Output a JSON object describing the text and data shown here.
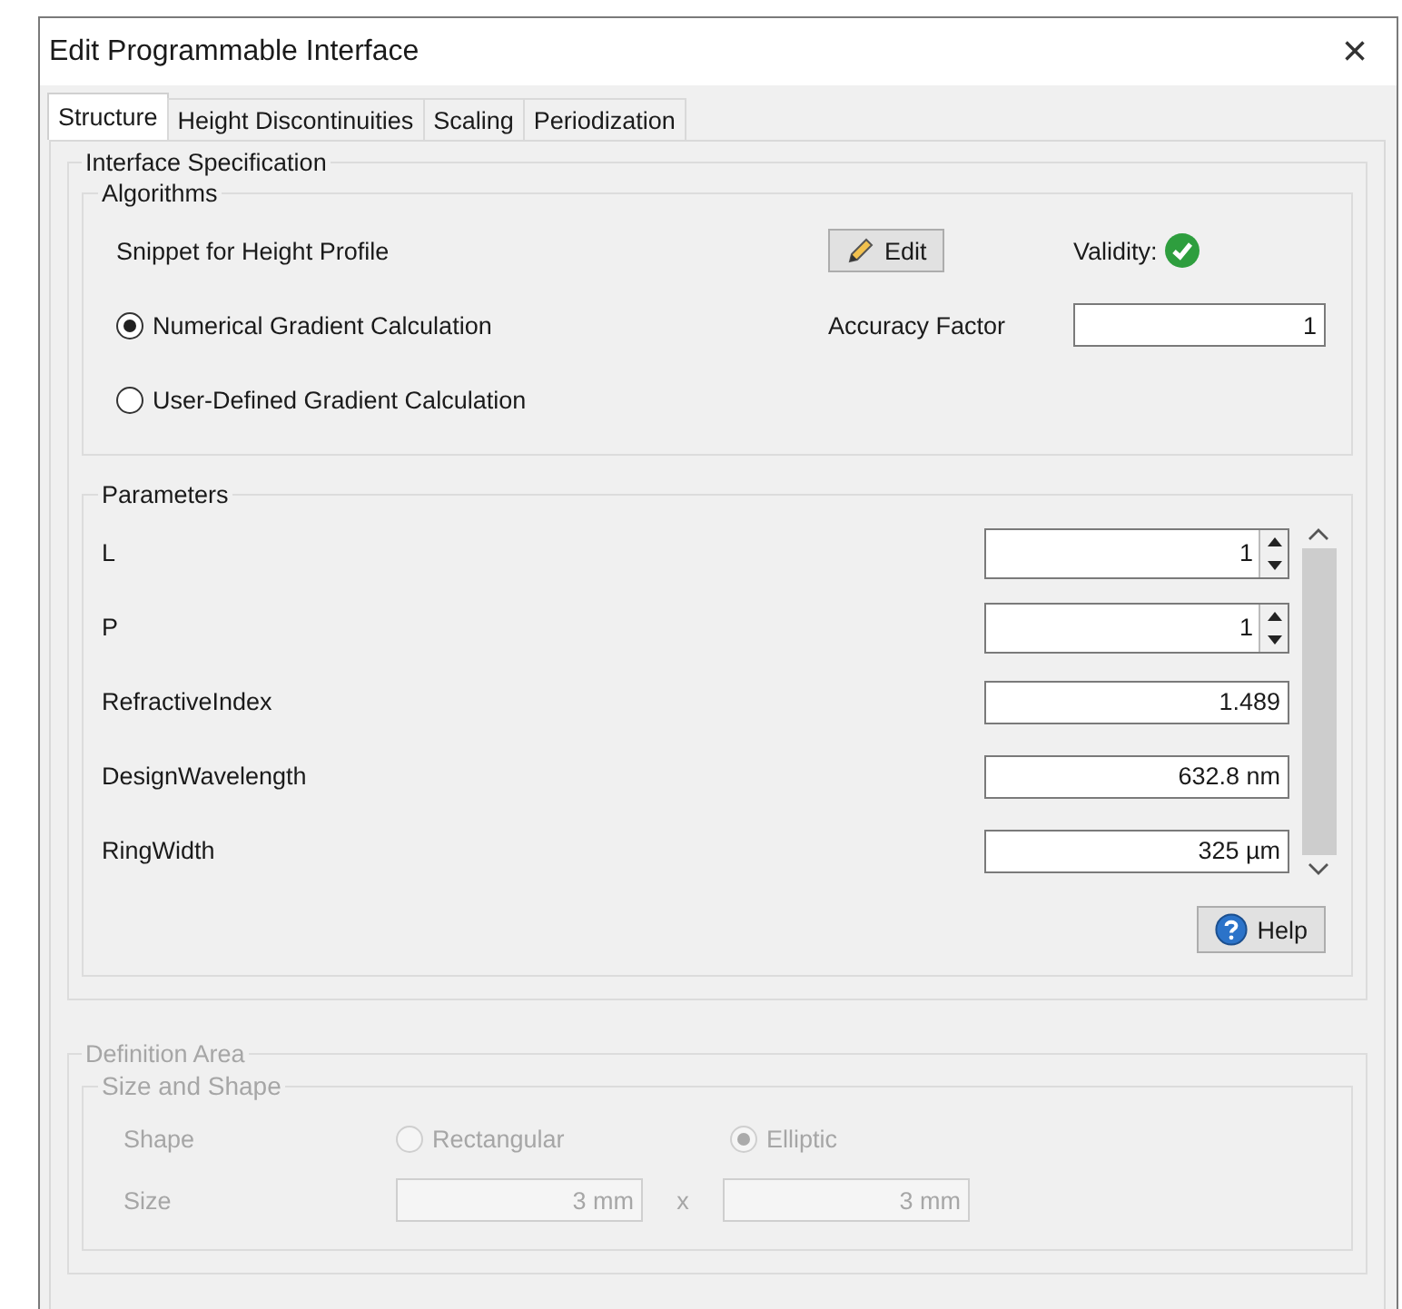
{
  "window": {
    "title": "Edit Programmable Interface",
    "close": "×"
  },
  "tabs": [
    {
      "label": "Structure",
      "selected": true
    },
    {
      "label": "Height Discontinuities",
      "selected": false
    },
    {
      "label": "Scaling",
      "selected": false
    },
    {
      "label": "Periodization",
      "selected": false
    }
  ],
  "interface_specification": {
    "title": "Interface Specification",
    "algorithms": {
      "title": "Algorithms",
      "snippet_label": "Snippet for Height Profile",
      "edit_button": "Edit",
      "validity_label": "Validity:",
      "valid": true,
      "options": [
        {
          "label": "Numerical Gradient Calculation",
          "selected": true
        },
        {
          "label": "User-Defined Gradient Calculation",
          "selected": false
        }
      ],
      "accuracy_label": "Accuracy Factor",
      "accuracy_value": "1"
    },
    "parameters": {
      "title": "Parameters",
      "help_button": "Help",
      "rows": [
        {
          "label": "L",
          "value": "1",
          "kind": "spinner"
        },
        {
          "label": "P",
          "value": "1",
          "kind": "spinner"
        },
        {
          "label": "RefractiveIndex",
          "value": "1.489",
          "kind": "text"
        },
        {
          "label": "DesignWavelength",
          "value": "632.8 nm",
          "kind": "text"
        },
        {
          "label": "RingWidth",
          "value": "325 µm",
          "kind": "text"
        }
      ]
    }
  },
  "definition_area": {
    "title": "Definition Area",
    "disabled": true,
    "size_and_shape": {
      "title": "Size and Shape",
      "shape_label": "Shape",
      "shapes": [
        {
          "label": "Rectangular",
          "selected": false
        },
        {
          "label": "Elliptic",
          "selected": true
        }
      ],
      "size_label": "Size",
      "width": "3 mm",
      "separator": "x",
      "height": "3 mm"
    }
  }
}
